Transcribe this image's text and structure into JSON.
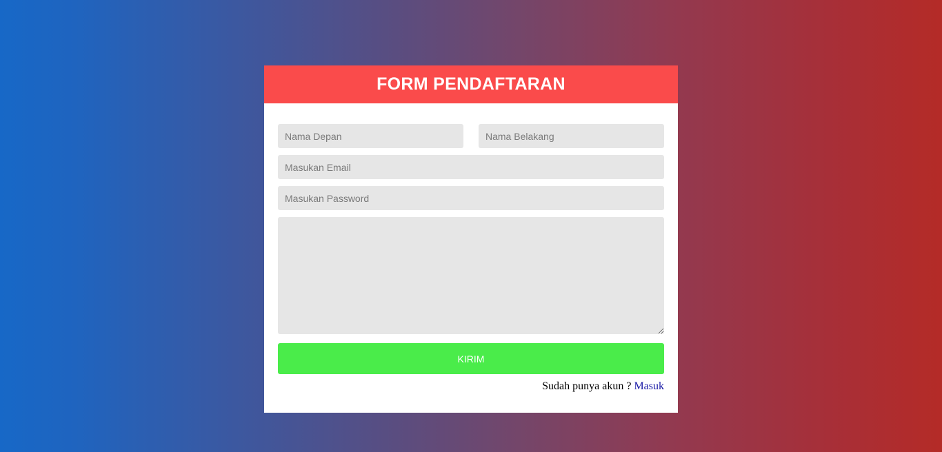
{
  "form": {
    "title": "FORM PENDAFTARAN",
    "first_name": {
      "value": "",
      "placeholder": "Nama Depan"
    },
    "last_name": {
      "value": "",
      "placeholder": "Nama Belakang"
    },
    "email": {
      "value": "",
      "placeholder": "Masukan Email"
    },
    "password": {
      "value": "",
      "placeholder": "Masukan Password"
    },
    "message": {
      "value": "",
      "placeholder": ""
    },
    "submit_label": "KIRIM",
    "footer_prompt": "Sudah punya akun ? ",
    "login_link_label": "Masuk"
  },
  "colors": {
    "header": "#fa4b4b",
    "submit": "#4aec4a",
    "field_bg": "#e6e6e6",
    "link": "#1a1aa6",
    "gradient_left": "#1768c7",
    "gradient_right": "#b42b27"
  }
}
